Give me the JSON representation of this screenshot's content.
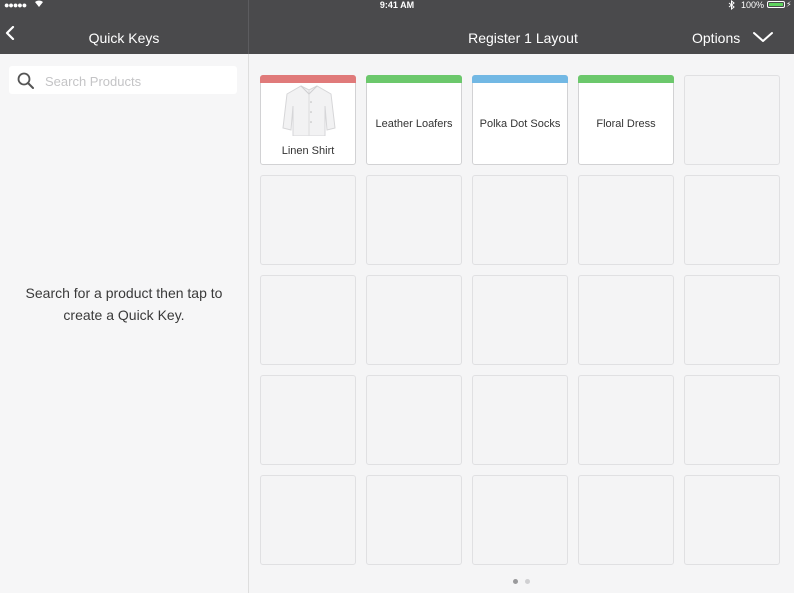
{
  "status_bar": {
    "signal": "●●●●●",
    "time": "9:41 AM",
    "battery_text": "100%",
    "battery_color": "#5fd35f"
  },
  "sidebar": {
    "title": "Quick Keys",
    "back_icon": "chevron-left-icon",
    "search": {
      "placeholder": "Search Products",
      "value": ""
    },
    "hint": "Search for a product then tap to create a Quick Key."
  },
  "main": {
    "title": "Register 1 Layout",
    "options_label": "Options",
    "options_icon": "chevron-down-icon"
  },
  "quick_keys": [
    {
      "label": "Linen Shirt",
      "color": "#e07a7a",
      "image": "shirt"
    },
    {
      "label": "Leather Loafers",
      "color": "#6cc86c"
    },
    {
      "label": "Polka Dot Socks",
      "color": "#72b8e4"
    },
    {
      "label": "Floral Dress",
      "color": "#6cc86c"
    }
  ],
  "grid": {
    "columns": 5,
    "rows": 5
  },
  "pager": {
    "pages": 2,
    "current": 1
  },
  "colors": {
    "topbar": "#4a4a4c",
    "page_dot_active": "#9a9a9c",
    "page_dot_inactive": "#d0d0d2"
  }
}
